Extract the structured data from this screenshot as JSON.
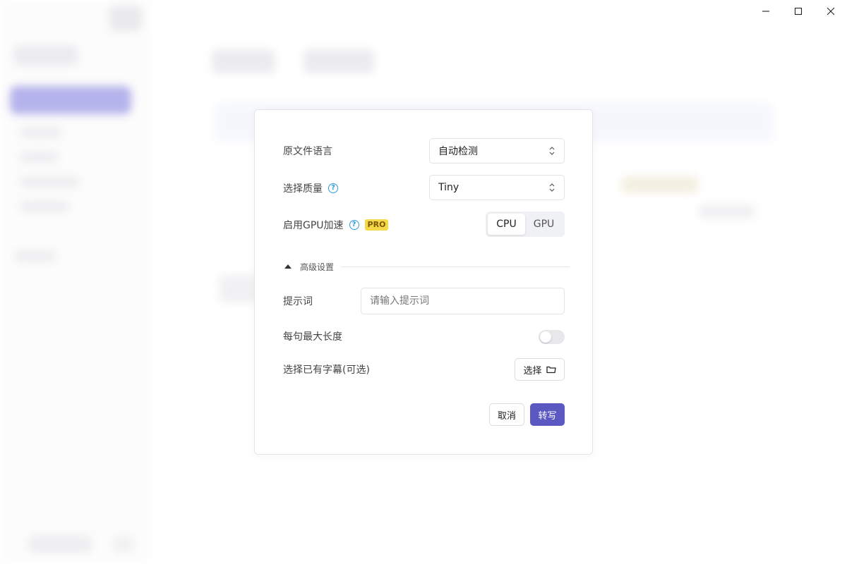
{
  "window_controls": {
    "minimize": "minimize-icon",
    "maximize": "maximize-icon",
    "close": "close-icon"
  },
  "dialog": {
    "source_language": {
      "label": "原文件语言",
      "value": "自动检测"
    },
    "quality": {
      "label": "选择质量",
      "help": "?",
      "value": "Tiny"
    },
    "gpu": {
      "label": "启用GPU加速",
      "help": "?",
      "badge": "PRO",
      "options": [
        "CPU",
        "GPU"
      ],
      "selected": "CPU"
    },
    "advanced": {
      "label": "高级设置",
      "expanded": true
    },
    "prompt": {
      "label": "提示词",
      "placeholder": "请输入提示词",
      "value": ""
    },
    "max_length": {
      "label": "每句最大长度",
      "enabled": false
    },
    "existing_subtitle": {
      "label": "选择已有字幕(可选)",
      "button": "选择"
    },
    "actions": {
      "cancel": "取消",
      "submit": "转写"
    }
  },
  "colors": {
    "primary": "#5b58c2",
    "help": "#2b9be0",
    "pro_badge": "#f6d94b"
  }
}
